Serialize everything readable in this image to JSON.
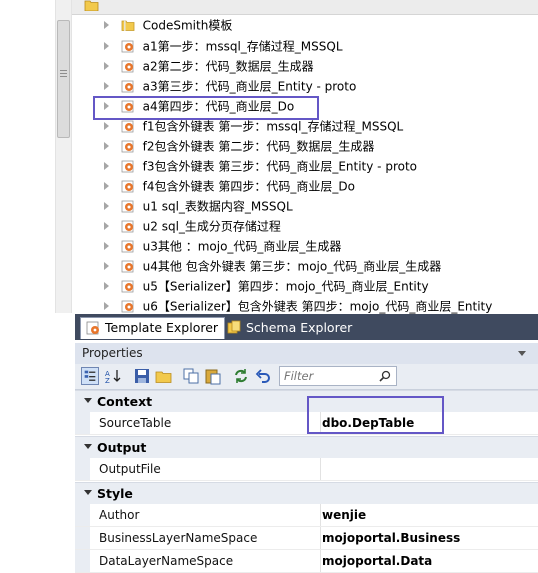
{
  "template_tree": {
    "items": [
      {
        "icon": "folder-icon",
        "label": "CodeSmith模板"
      },
      {
        "icon": "template-icon",
        "label": "a1第一步：mssql_存储过程_MSSQL"
      },
      {
        "icon": "template-icon",
        "label": "a2第二步：代码_数据层_生成器"
      },
      {
        "icon": "template-icon",
        "label": "a3第三步：代码_商业层_Entity - proto"
      },
      {
        "icon": "template-icon",
        "label": "a4第四步：代码_商业层_Do"
      },
      {
        "icon": "template-icon",
        "label": "f1包含外键表   第一步：mssql_存储过程_MSSQL"
      },
      {
        "icon": "template-icon",
        "label": "f2包含外键表   第二步：代码_数据层_生成器"
      },
      {
        "icon": "template-icon",
        "label": "f3包含外键表   第三步：代码_商业层_Entity - proto"
      },
      {
        "icon": "template-icon",
        "label": "f4包含外键表   第四步：代码_商业层_Do"
      },
      {
        "icon": "template-icon",
        "label": "u1 sql_表数据内容_MSSQL"
      },
      {
        "icon": "template-icon",
        "label": "u2 sql_生成分页存储过程"
      },
      {
        "icon": "template-icon",
        "label": "u3其他 ：mojo_代码_商业层_生成器"
      },
      {
        "icon": "template-icon",
        "label": "u4其他 包含外键表   第三步：mojo_代码_商业层_生成器"
      },
      {
        "icon": "template-icon",
        "label": "u5【Serializer】第四步：mojo_代码_商业层_Entity"
      },
      {
        "icon": "template-icon",
        "label": "u6【Serializer】包含外键表   第四步：mojo_代码_商业层_Entity"
      }
    ]
  },
  "tabs": [
    {
      "label": "Template Explorer",
      "icon": "template-explorer-icon"
    },
    {
      "label": "Schema Explorer",
      "icon": "schema-explorer-icon"
    }
  ],
  "properties": {
    "title": "Properties",
    "filter_placeholder": "Filter",
    "categories": [
      {
        "name": "Context",
        "rows": [
          {
            "name": "SourceTable",
            "value": "dbo.DepTable"
          }
        ]
      },
      {
        "name": "Output",
        "rows": [
          {
            "name": "OutputFile",
            "value": ""
          }
        ]
      },
      {
        "name": "Style",
        "rows": [
          {
            "name": "Author",
            "value": "wenjie"
          },
          {
            "name": "BusinessLayerNameSpace",
            "value": "mojoportal.Business"
          },
          {
            "name": "DataLayerNameSpace",
            "value": "mojoportal.Data"
          }
        ]
      }
    ]
  },
  "colors": {
    "tabs_bar": "#3f4a5f",
    "highlight_box": "#6457c6",
    "panel_header": "#dde3ee",
    "template_icon": "#e8762c",
    "folder_icon": "#f2c94c"
  }
}
